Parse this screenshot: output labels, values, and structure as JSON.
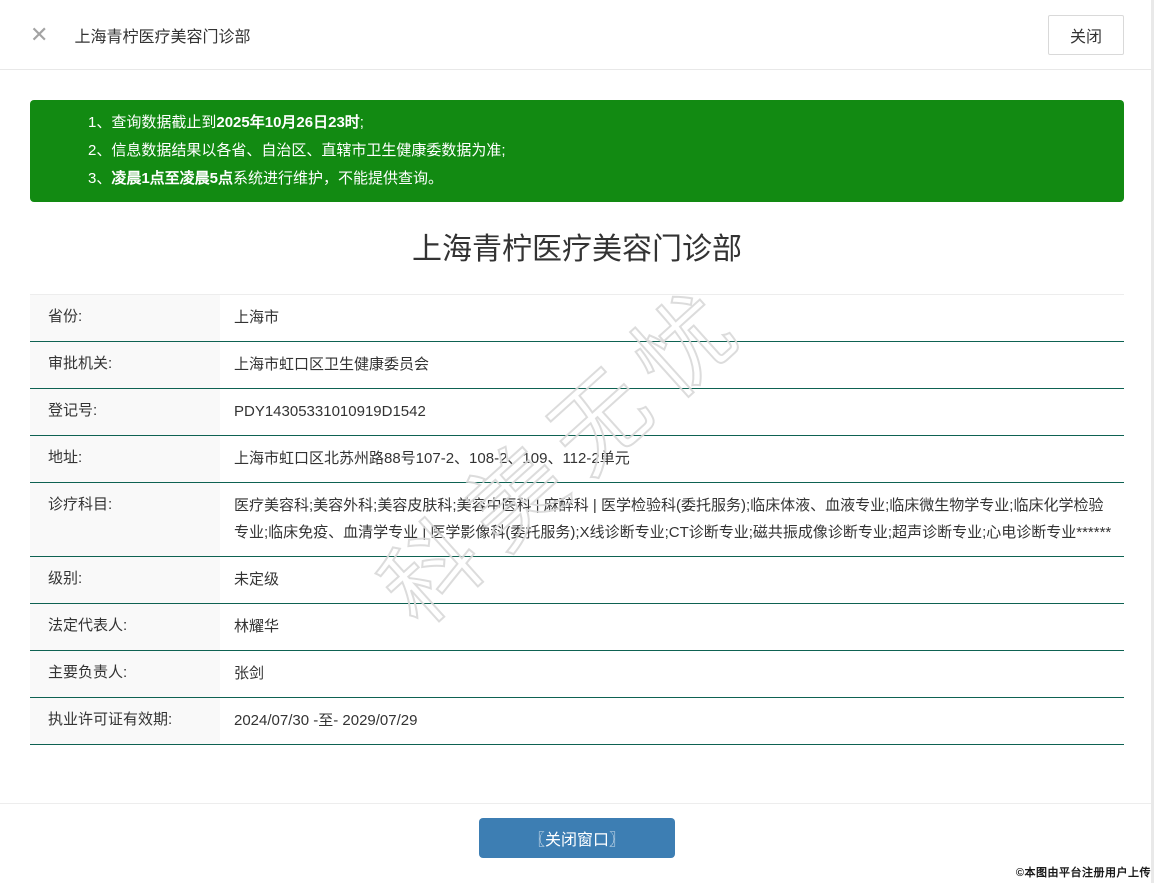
{
  "header": {
    "close_icon": "✕",
    "title": "上海青柠医疗美容门诊部",
    "close_button_label": "关闭"
  },
  "notice": {
    "items": [
      {
        "num": "1、",
        "pre": "查询数据截止到",
        "bold": "2025年10月26日23时",
        "post": ";"
      },
      {
        "num": "2、",
        "pre": "信息数据结果以各省、自治区、直辖市卫生健康委数据为准;",
        "bold": "",
        "post": ""
      },
      {
        "num": "3、",
        "pre": "",
        "bold": "凌晨1点至凌晨5点",
        "post": "系统进行维护，不能提供查询。"
      }
    ]
  },
  "main": {
    "title": "上海青柠医疗美容门诊部",
    "rows": [
      {
        "label": "省份:",
        "value": "上海市"
      },
      {
        "label": "审批机关:",
        "value": "上海市虹口区卫生健康委员会"
      },
      {
        "label": "登记号:",
        "value": "PDY14305331010919D1542"
      },
      {
        "label": "地址:",
        "value": "上海市虹口区北苏州路88号107-2、108-2、109、112-2单元"
      },
      {
        "label": "诊疗科目:",
        "value": "医疗美容科;美容外科;美容皮肤科;美容中医科 | 麻醉科 | 医学检验科(委托服务);临床体液、血液专业;临床微生物学专业;临床化学检验专业;临床免疫、血清学专业 | 医学影像科(委托服务);X线诊断专业;CT诊断专业;磁共振成像诊断专业;超声诊断专业;心电诊断专业******"
      },
      {
        "label": "级别:",
        "value": "未定级"
      },
      {
        "label": "法定代表人:",
        "value": "林耀华"
      },
      {
        "label": "主要负责人:",
        "value": "张剑"
      },
      {
        "label": "执业许可证有效期:",
        "value": "2024/07/30 -至- 2029/07/29"
      }
    ]
  },
  "watermark": {
    "text": "科美无忧"
  },
  "footer": {
    "close_window_label": "〖关闭窗口〗",
    "credit": "©本图由平台注册用户上传"
  },
  "colors": {
    "notice_bg": "#128a12",
    "row_divider": "#0e6252",
    "primary_button_bg": "#3d7eb3",
    "label_cell_bg": "#f9f9f9"
  }
}
